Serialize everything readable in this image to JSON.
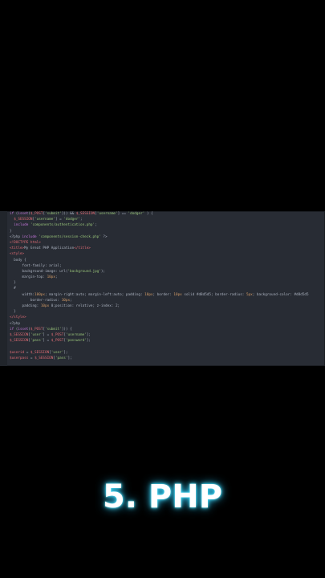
{
  "editor": {
    "lines": [
      "if (isset($_POST['submit'])) && $_SESSION['username'] == 'dodger' ) {",
      "  $_SESSION['username'] = 'dodger';",
      "  include 'components/authentication.php';",
      "}",
      "<?php include 'components/session-check.php' ?>",
      "<!DOCTYPE html>",
      "<title>My Great PHP Application</title>",
      "<style>",
      "  body {",
      "      font-family: arial;",
      "      background-image: url('background.jpg');",
      "      margin-top: 10px;",
      "  }",
      "  #",
      "      width:100px; margin-right:auto; margin-left:auto; padding: 10px; border: 10px solid #d8d5d5; border-radius: 5px; background-color: #d8d5d5",
      "          border-radius: 10px;",
      "      padding: 10px 0;position: relative; z-index: 2;",
      "  }",
      "</style>",
      "<?php",
      "if (isset($_POST['submit'])) {",
      "$_SESSION['user'] = $_POST['username'];",
      "$_SESSION['pass'] = $_POST['password'];",
      "",
      "$userid = $_SESSION['user'];",
      "$userpass = $_SESSION['pass'];"
    ]
  },
  "caption": "5. PHP",
  "colors": {
    "background": "#000000",
    "editor_bg": "#282c34",
    "caption_glow": "#3fe0ff"
  }
}
